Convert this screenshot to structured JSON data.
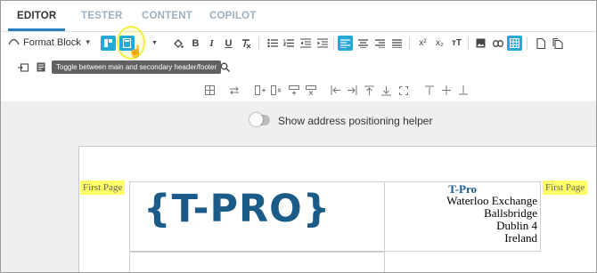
{
  "tabs": [
    {
      "label": "EDITOR",
      "active": true
    },
    {
      "label": "TESTER",
      "active": false
    },
    {
      "label": "CONTENT",
      "active": false
    },
    {
      "label": "COPILOT",
      "active": false
    }
  ],
  "toolbar": {
    "format_block_label": "Format Block",
    "tooltip": "Toggle between main and secondary header/footer"
  },
  "helper": {
    "label": "Show address positioning helper",
    "enabled": false
  },
  "page": {
    "first_page_left": "First Page",
    "first_page_right": "First Page",
    "logo_text": "{T-PRO}",
    "company_name": "T-Pro",
    "address_lines": [
      "Waterloo Exchange",
      "Ballsbridge",
      "Dublin 4",
      "Ireland"
    ]
  },
  "colors": {
    "accent": "#23a9d8",
    "tab_underline": "#2a7fc1",
    "logo": "#1b5b87",
    "highlight": "#ffff66"
  }
}
